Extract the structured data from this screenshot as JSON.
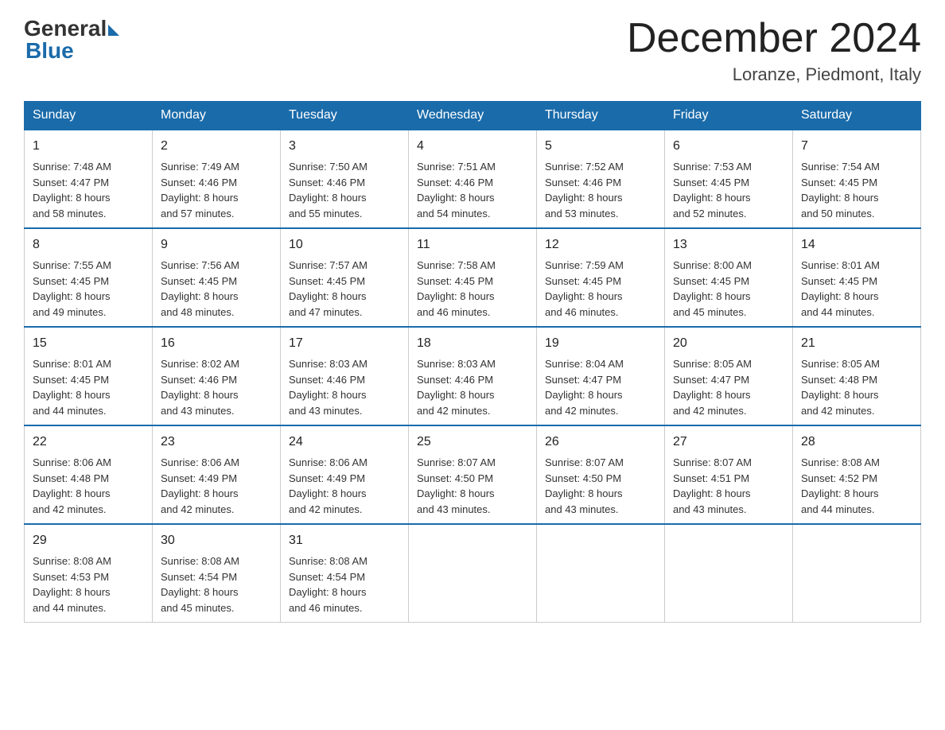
{
  "logo": {
    "general": "General",
    "blue": "Blue"
  },
  "header": {
    "month": "December 2024",
    "location": "Loranze, Piedmont, Italy"
  },
  "days_of_week": [
    "Sunday",
    "Monday",
    "Tuesday",
    "Wednesday",
    "Thursday",
    "Friday",
    "Saturday"
  ],
  "weeks": [
    [
      {
        "day": "1",
        "sunrise": "7:48 AM",
        "sunset": "4:47 PM",
        "daylight": "8 hours and 58 minutes."
      },
      {
        "day": "2",
        "sunrise": "7:49 AM",
        "sunset": "4:46 PM",
        "daylight": "8 hours and 57 minutes."
      },
      {
        "day": "3",
        "sunrise": "7:50 AM",
        "sunset": "4:46 PM",
        "daylight": "8 hours and 55 minutes."
      },
      {
        "day": "4",
        "sunrise": "7:51 AM",
        "sunset": "4:46 PM",
        "daylight": "8 hours and 54 minutes."
      },
      {
        "day": "5",
        "sunrise": "7:52 AM",
        "sunset": "4:46 PM",
        "daylight": "8 hours and 53 minutes."
      },
      {
        "day": "6",
        "sunrise": "7:53 AM",
        "sunset": "4:45 PM",
        "daylight": "8 hours and 52 minutes."
      },
      {
        "day": "7",
        "sunrise": "7:54 AM",
        "sunset": "4:45 PM",
        "daylight": "8 hours and 50 minutes."
      }
    ],
    [
      {
        "day": "8",
        "sunrise": "7:55 AM",
        "sunset": "4:45 PM",
        "daylight": "8 hours and 49 minutes."
      },
      {
        "day": "9",
        "sunrise": "7:56 AM",
        "sunset": "4:45 PM",
        "daylight": "8 hours and 48 minutes."
      },
      {
        "day": "10",
        "sunrise": "7:57 AM",
        "sunset": "4:45 PM",
        "daylight": "8 hours and 47 minutes."
      },
      {
        "day": "11",
        "sunrise": "7:58 AM",
        "sunset": "4:45 PM",
        "daylight": "8 hours and 46 minutes."
      },
      {
        "day": "12",
        "sunrise": "7:59 AM",
        "sunset": "4:45 PM",
        "daylight": "8 hours and 46 minutes."
      },
      {
        "day": "13",
        "sunrise": "8:00 AM",
        "sunset": "4:45 PM",
        "daylight": "8 hours and 45 minutes."
      },
      {
        "day": "14",
        "sunrise": "8:01 AM",
        "sunset": "4:45 PM",
        "daylight": "8 hours and 44 minutes."
      }
    ],
    [
      {
        "day": "15",
        "sunrise": "8:01 AM",
        "sunset": "4:45 PM",
        "daylight": "8 hours and 44 minutes."
      },
      {
        "day": "16",
        "sunrise": "8:02 AM",
        "sunset": "4:46 PM",
        "daylight": "8 hours and 43 minutes."
      },
      {
        "day": "17",
        "sunrise": "8:03 AM",
        "sunset": "4:46 PM",
        "daylight": "8 hours and 43 minutes."
      },
      {
        "day": "18",
        "sunrise": "8:03 AM",
        "sunset": "4:46 PM",
        "daylight": "8 hours and 42 minutes."
      },
      {
        "day": "19",
        "sunrise": "8:04 AM",
        "sunset": "4:47 PM",
        "daylight": "8 hours and 42 minutes."
      },
      {
        "day": "20",
        "sunrise": "8:05 AM",
        "sunset": "4:47 PM",
        "daylight": "8 hours and 42 minutes."
      },
      {
        "day": "21",
        "sunrise": "8:05 AM",
        "sunset": "4:48 PM",
        "daylight": "8 hours and 42 minutes."
      }
    ],
    [
      {
        "day": "22",
        "sunrise": "8:06 AM",
        "sunset": "4:48 PM",
        "daylight": "8 hours and 42 minutes."
      },
      {
        "day": "23",
        "sunrise": "8:06 AM",
        "sunset": "4:49 PM",
        "daylight": "8 hours and 42 minutes."
      },
      {
        "day": "24",
        "sunrise": "8:06 AM",
        "sunset": "4:49 PM",
        "daylight": "8 hours and 42 minutes."
      },
      {
        "day": "25",
        "sunrise": "8:07 AM",
        "sunset": "4:50 PM",
        "daylight": "8 hours and 43 minutes."
      },
      {
        "day": "26",
        "sunrise": "8:07 AM",
        "sunset": "4:50 PM",
        "daylight": "8 hours and 43 minutes."
      },
      {
        "day": "27",
        "sunrise": "8:07 AM",
        "sunset": "4:51 PM",
        "daylight": "8 hours and 43 minutes."
      },
      {
        "day": "28",
        "sunrise": "8:08 AM",
        "sunset": "4:52 PM",
        "daylight": "8 hours and 44 minutes."
      }
    ],
    [
      {
        "day": "29",
        "sunrise": "8:08 AM",
        "sunset": "4:53 PM",
        "daylight": "8 hours and 44 minutes."
      },
      {
        "day": "30",
        "sunrise": "8:08 AM",
        "sunset": "4:54 PM",
        "daylight": "8 hours and 45 minutes."
      },
      {
        "day": "31",
        "sunrise": "8:08 AM",
        "sunset": "4:54 PM",
        "daylight": "8 hours and 46 minutes."
      },
      null,
      null,
      null,
      null
    ]
  ],
  "labels": {
    "sunrise": "Sunrise:",
    "sunset": "Sunset:",
    "daylight": "Daylight:"
  }
}
